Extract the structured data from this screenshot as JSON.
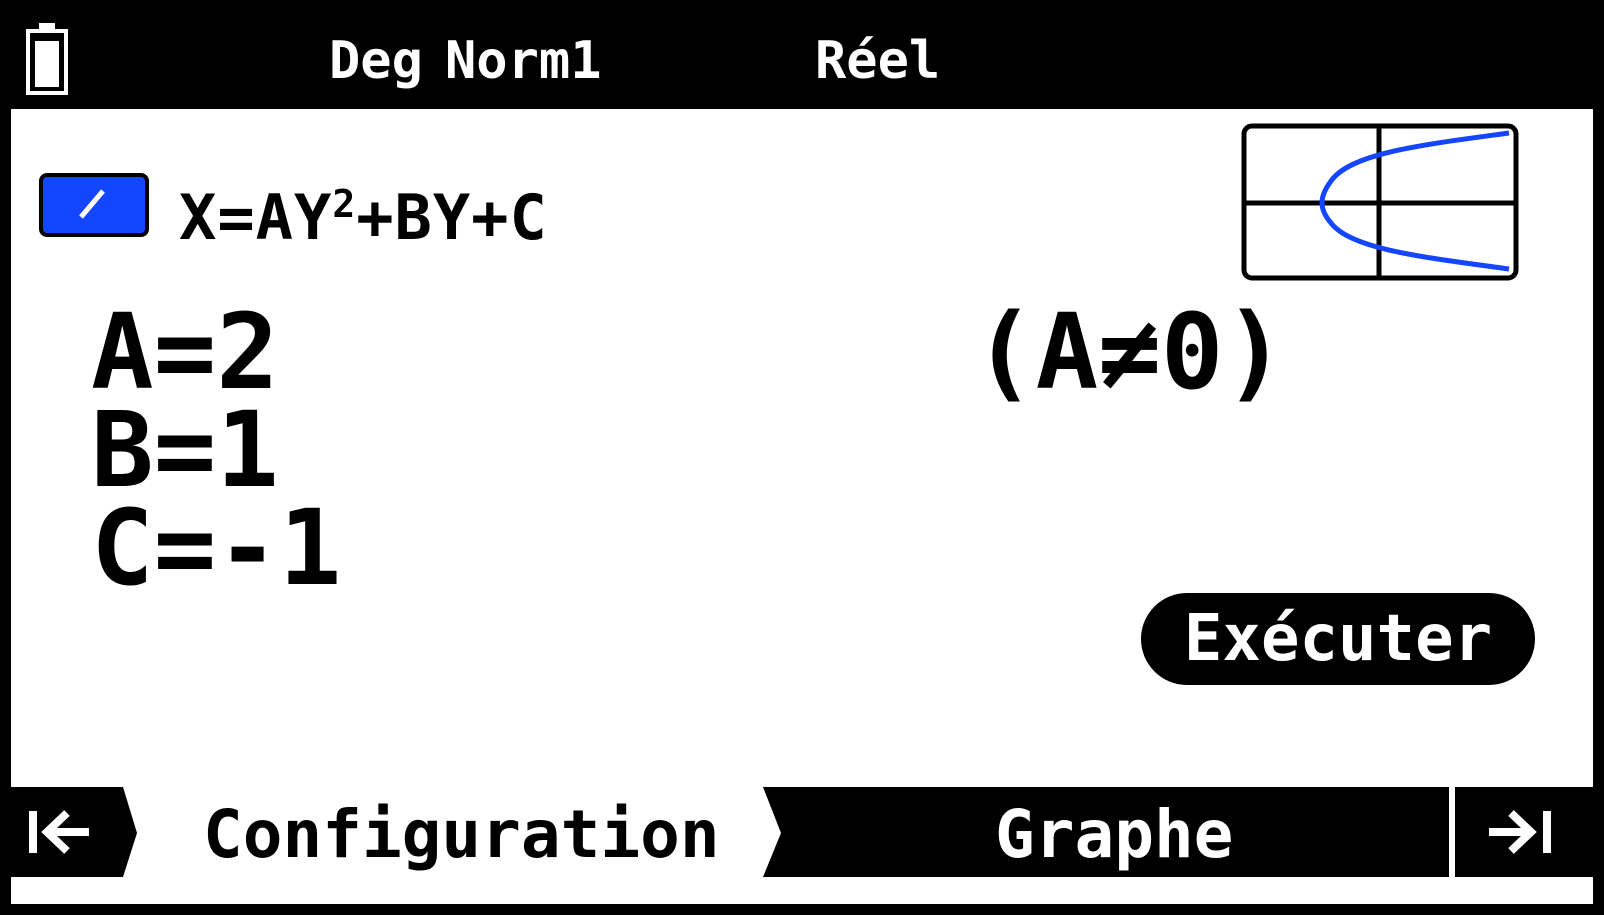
{
  "status_bar": {
    "angle_mode": "Deg",
    "display_mode": "Norm1",
    "complex_mode": "Réel",
    "battery_icon": "battery-icon"
  },
  "equation": {
    "color_swatch": "#1546ff",
    "lhs": "X=AY",
    "exponent": "2",
    "rhs": "+BY+C"
  },
  "params": {
    "a": "A=2",
    "b": "B=1",
    "c": "C=-1"
  },
  "constraint": "(A≠0)",
  "execute_label": "Exécuter",
  "tabs": {
    "prev_icon": "|←",
    "config": "Configuration",
    "graph": "Graphe",
    "next_icon": "→|"
  },
  "colors": {
    "accent_blue": "#1546ff",
    "background": "#ffffff",
    "foreground": "#000000"
  }
}
